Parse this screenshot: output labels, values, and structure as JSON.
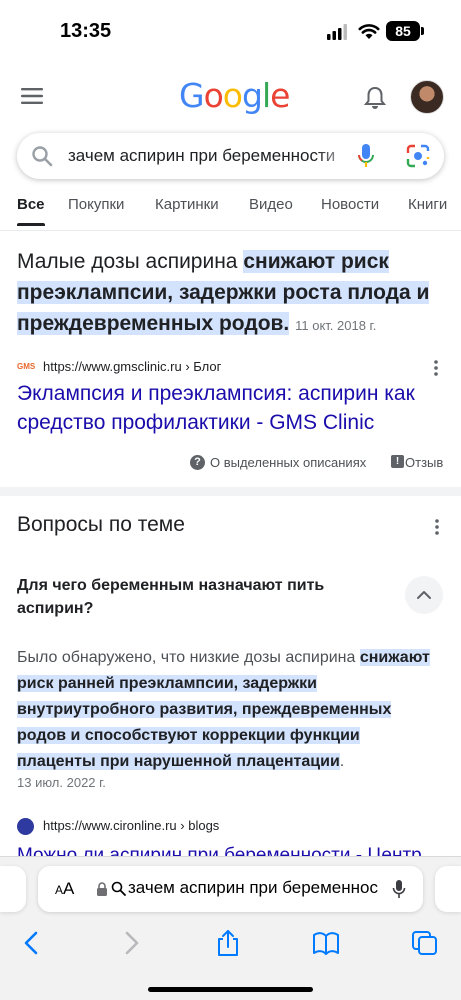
{
  "status_bar": {
    "time": "13:35",
    "battery": "85"
  },
  "header": {
    "logo_letters": [
      {
        "ch": "G",
        "color": "#4285F4"
      },
      {
        "ch": "o",
        "color": "#EA4335"
      },
      {
        "ch": "o",
        "color": "#FBBC05"
      },
      {
        "ch": "g",
        "color": "#4285F4"
      },
      {
        "ch": "l",
        "color": "#34A853"
      },
      {
        "ch": "e",
        "color": "#EA4335"
      }
    ]
  },
  "search": {
    "query": "зачем аспирин при беременности"
  },
  "tabs": [
    "Все",
    "Покупки",
    "Картинки",
    "Видео",
    "Новости",
    "Книги"
  ],
  "snippet": {
    "text_plain": "Малые дозы аспирина ",
    "text_highlight": "снижают риск преэклампсии, задержки роста плода и преждевременных родов.",
    "date": "11 окт. 2018 г.",
    "favicon": "GMS",
    "source_url": "https://www.gmsclinic.ru › Блог",
    "title": "Эклампсия и преэклампсия: аспирин как средство профилактики - GMS Clinic",
    "about_label": "О выделенных описаниях",
    "feedback_label": "Отзыв"
  },
  "related": {
    "title": "Вопросы по теме",
    "question": "Для чего беременным назначают пить аспирин?",
    "answer_plain": "Было обнаружено, что низкие дозы аспирина ",
    "answer_highlight": "снижают риск ранней преэклампсии, задержки внутриутробного развития, преждевременных родов и способствуют коррекции функции плаценты при нарушенной плацентации",
    "answer_end": ".",
    "date": "13 июл. 2022 г.",
    "source_url": "https://www.cironline.ru › blogs",
    "result_title": "Можно ли аспирин при беременности - Центр"
  },
  "safari": {
    "aa_label_small": "A",
    "aa_label_big": "A",
    "address": "зачем аспирин при беременности"
  },
  "colors": {
    "link": "#1a0dab",
    "highlight": "#d3e3fd",
    "safari_blue": "#007AFF"
  }
}
